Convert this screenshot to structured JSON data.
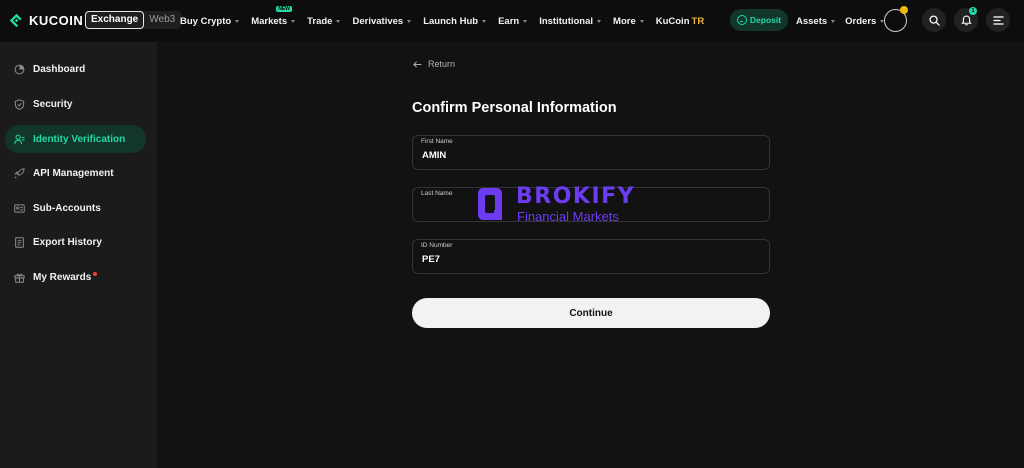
{
  "header": {
    "logo_text": "KUCOIN",
    "mode_exchange": "Exchange",
    "mode_web3": "Web3",
    "nav": [
      {
        "label": "Buy Crypto",
        "has_caret": true
      },
      {
        "label": "Markets",
        "has_caret": true,
        "badge": "NEW"
      },
      {
        "label": "Trade",
        "has_caret": true
      },
      {
        "label": "Derivatives",
        "has_caret": true
      },
      {
        "label": "Launch Hub",
        "has_caret": true
      },
      {
        "label": "Earn",
        "has_caret": true
      },
      {
        "label": "Institutional",
        "has_caret": true
      },
      {
        "label": "More",
        "has_caret": true
      }
    ],
    "kucoin_tr": {
      "label": "KuCoin",
      "suffix": "TR"
    },
    "deposit_label": "Deposit",
    "assets_label": "Assets",
    "orders_label": "Orders",
    "notification_count": "1"
  },
  "sidebar": {
    "items": [
      {
        "label": "Dashboard",
        "icon": "dashboard-icon",
        "active": false
      },
      {
        "label": "Security",
        "icon": "shield-icon",
        "active": false
      },
      {
        "label": "Identity Verification",
        "icon": "user-check-icon",
        "active": true
      },
      {
        "label": "API Management",
        "icon": "rocket-icon",
        "active": false
      },
      {
        "label": "Sub-Accounts",
        "icon": "accounts-icon",
        "active": false
      },
      {
        "label": "Export History",
        "icon": "document-icon",
        "active": false
      },
      {
        "label": "My Rewards",
        "icon": "gift-icon",
        "active": false
      }
    ]
  },
  "main": {
    "return_label": "Return",
    "title": "Confirm Personal Information",
    "fields": [
      {
        "label": "First Name",
        "value": "AMIN"
      },
      {
        "label": "Last Name",
        "value": ""
      },
      {
        "label": "ID Number",
        "value": "PE7"
      }
    ],
    "continue_label": "Continue"
  },
  "watermark": {
    "brand": "BROKIFY",
    "subtitle": "Financial Markets"
  },
  "colors": {
    "accent": "#23d9a5",
    "background": "#121212",
    "sidebar": "#1b1b1b",
    "watermark": "#6c3cf0"
  }
}
